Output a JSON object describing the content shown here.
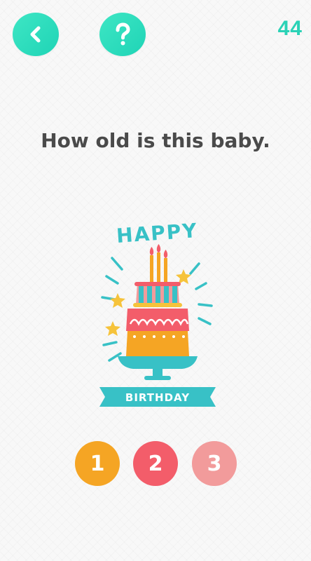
{
  "header": {
    "back_icon": "chevron-left-icon",
    "help_icon": "question-mark-icon",
    "level": "44",
    "accent_color": "#2ad2b6"
  },
  "question": {
    "text": "How old is this baby."
  },
  "illustration": {
    "icon": "birthday-cake-icon",
    "top_text": "HAPPY",
    "ribbon_text": "BIRTHDAY"
  },
  "answers": {
    "options": [
      {
        "label": "1",
        "color": "#f5a524"
      },
      {
        "label": "2",
        "color": "#f35d6a"
      },
      {
        "label": "3",
        "color": "#f29b9b"
      }
    ]
  }
}
